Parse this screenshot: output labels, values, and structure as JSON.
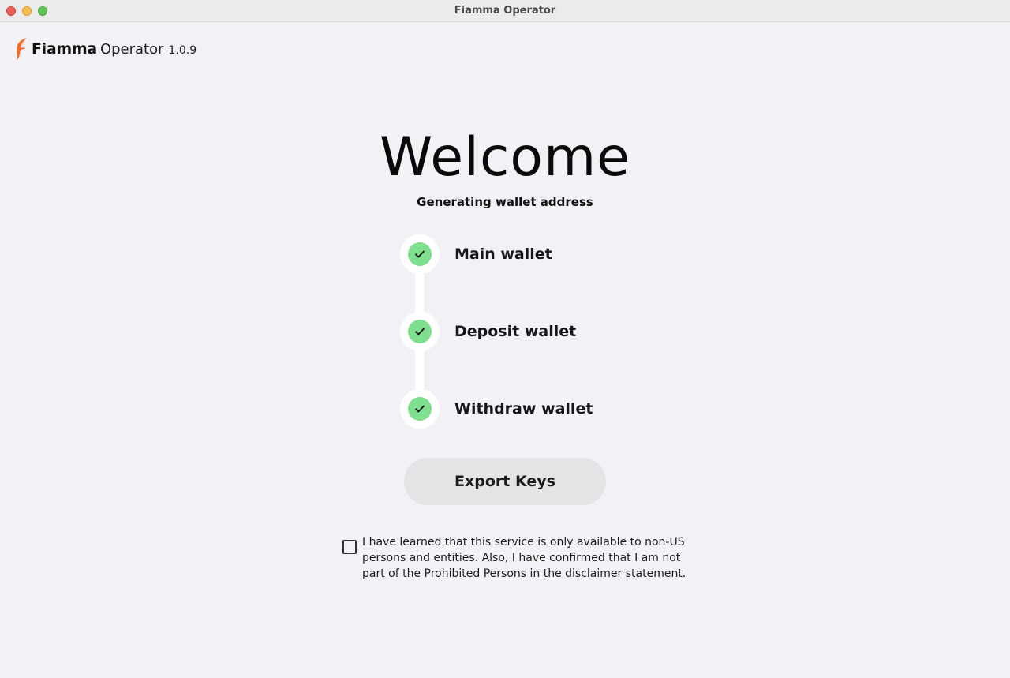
{
  "window": {
    "title": "Fiamma Operator"
  },
  "brand": {
    "name": "Fiamma",
    "product": "Operator",
    "version": "1.0.9",
    "logo_icon": "flame-logo",
    "accent_color": "#f26b2a"
  },
  "welcome": {
    "title": "Welcome",
    "subtitle": "Generating wallet address"
  },
  "steps": [
    {
      "label": "Main wallet",
      "status": "done",
      "icon": "checkmark-icon"
    },
    {
      "label": "Deposit wallet",
      "status": "done",
      "icon": "checkmark-icon"
    },
    {
      "label": "Withdraw wallet",
      "status": "done",
      "icon": "checkmark-icon"
    }
  ],
  "step_done_color": "#7ee08f",
  "actions": {
    "export_label": "Export Keys"
  },
  "agreement": {
    "checked": false,
    "text": "I have learned that this service is only available to non-US persons and entities. Also, I have confirmed that I am not part of the Prohibited Persons in the disclaimer statement."
  }
}
